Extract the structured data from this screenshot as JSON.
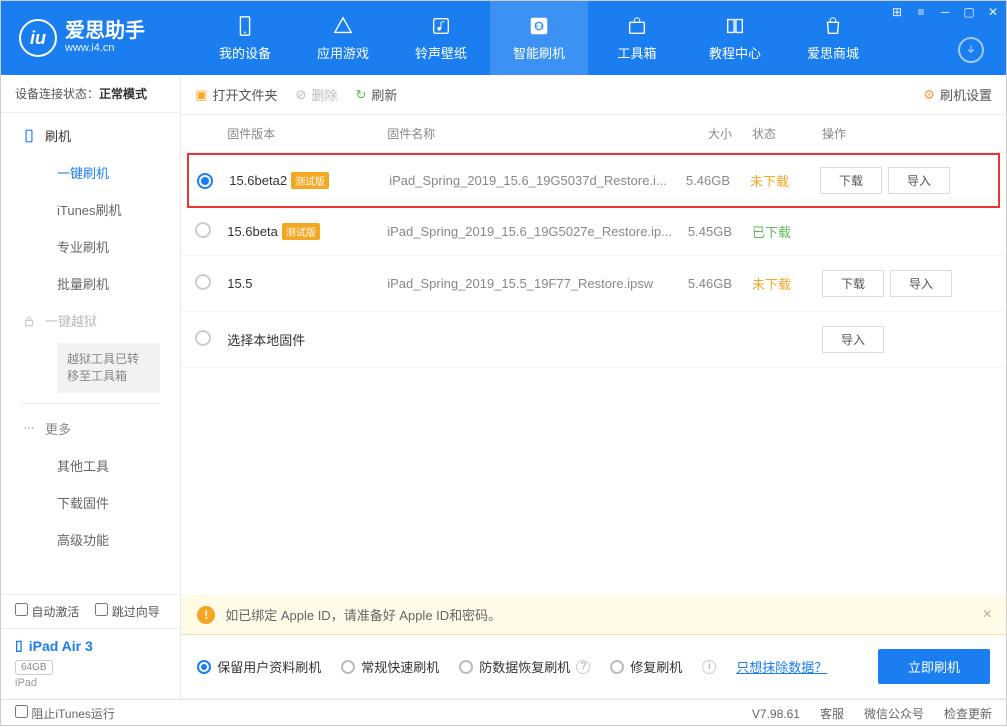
{
  "app": {
    "name": "爱思助手",
    "domain": "www.i4.cn"
  },
  "nav": [
    {
      "label": "我的设备"
    },
    {
      "label": "应用游戏"
    },
    {
      "label": "铃声壁纸"
    },
    {
      "label": "智能刷机"
    },
    {
      "label": "工具箱"
    },
    {
      "label": "教程中心"
    },
    {
      "label": "爱思商城"
    }
  ],
  "status": {
    "label": "设备连接状态：",
    "value": "正常模式"
  },
  "sidebar": {
    "flash": {
      "label": "刷机"
    },
    "one_click": {
      "label": "一键刷机"
    },
    "itunes": {
      "label": "iTunes刷机"
    },
    "pro": {
      "label": "专业刷机"
    },
    "batch": {
      "label": "批量刷机"
    },
    "jailbreak": {
      "label": "一键越狱"
    },
    "jb_note": "越狱工具已转移至工具箱",
    "more": {
      "label": "更多"
    },
    "other_tools": {
      "label": "其他工具"
    },
    "download_fw": {
      "label": "下载固件"
    },
    "advanced": {
      "label": "高级功能"
    }
  },
  "checks": {
    "auto_activate": "自动激活",
    "skip_guide": "跳过向导"
  },
  "device": {
    "name": "iPad Air 3",
    "storage": "64GB",
    "type": "iPad"
  },
  "toolbar": {
    "open_folder": "打开文件夹",
    "delete": "删除",
    "refresh": "刷新",
    "settings": "刷机设置"
  },
  "headers": {
    "version": "固件版本",
    "name": "固件名称",
    "size": "大小",
    "status": "状态",
    "ops": "操作"
  },
  "ops": {
    "download": "下载",
    "import": "导入"
  },
  "badge_beta": "测试版",
  "rows": [
    {
      "version": "15.6beta2",
      "beta": true,
      "name": "iPad_Spring_2019_15.6_19G5037d_Restore.i...",
      "size": "5.46GB",
      "status": "未下载",
      "status_cls": "orange",
      "selected": true,
      "highlight": true,
      "show_ops": true
    },
    {
      "version": "15.6beta",
      "beta": true,
      "name": "iPad_Spring_2019_15.6_19G5027e_Restore.ip...",
      "size": "5.45GB",
      "status": "已下载",
      "status_cls": "green",
      "selected": false,
      "show_ops": false
    },
    {
      "version": "15.5",
      "beta": false,
      "name": "iPad_Spring_2019_15.5_19F77_Restore.ipsw",
      "size": "5.46GB",
      "status": "未下载",
      "status_cls": "orange",
      "selected": false,
      "show_ops": true
    }
  ],
  "local_row": {
    "label": "选择本地固件"
  },
  "warning": "如已绑定 Apple ID，请准备好 Apple ID和密码。",
  "options": {
    "keep_data": "保留用户资料刷机",
    "normal": "常规快速刷机",
    "anti_data": "防数据恢复刷机",
    "repair": "修复刷机",
    "erase_link": "只想抹除数据？"
  },
  "primary": "立即刷机",
  "footer": {
    "block_itunes": "阻止iTunes运行",
    "version": "V7.98.61",
    "service": "客服",
    "wechat": "微信公众号",
    "check_update": "检查更新"
  }
}
